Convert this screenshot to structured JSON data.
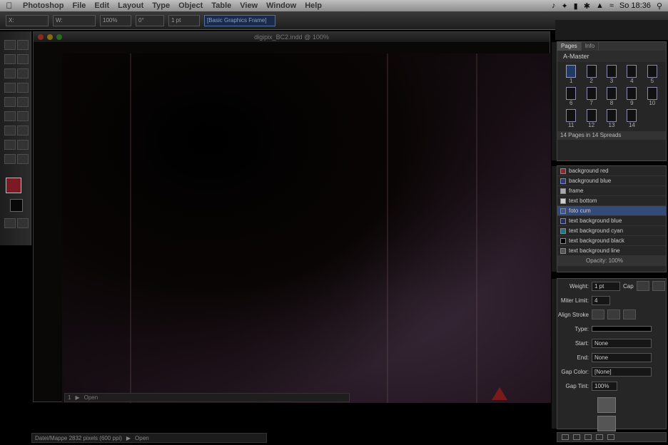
{
  "menubar": {
    "items": [
      "Photoshop",
      "File",
      "Edit",
      "Layout",
      "Type",
      "Object",
      "Table",
      "View",
      "Window",
      "Help"
    ],
    "clock": "So 18:36"
  },
  "control_bar": {
    "fields": [
      "X:",
      "W:",
      "100%",
      "0°",
      "1 pt"
    ],
    "frame_style": "[Basic Graphics Frame]"
  },
  "document": {
    "title": "digipix_BC2.indd @ 100%",
    "status_page": "1",
    "status_text": "Open"
  },
  "bottom_status": {
    "text": "Datei/Mappe 2832 pixels (600 ppi)",
    "open_label": "Open"
  },
  "pages_panel": {
    "tabs": [
      "Pages",
      "Info"
    ],
    "master_label": "A-Master",
    "page_numbers": [
      "1",
      "2",
      "3",
      "4",
      "5",
      "6",
      "7",
      "8",
      "9",
      "10",
      "11",
      "12",
      "13",
      "14"
    ],
    "footer": "14 Pages in 14 Spreads"
  },
  "swatches_panel": {
    "items": [
      {
        "name": "background red",
        "color": "#8a2a2a"
      },
      {
        "name": "background blue",
        "color": "#2a3a8a"
      },
      {
        "name": "frame",
        "color": "#aaaaaa"
      },
      {
        "name": "text bottom",
        "color": "#cfcfcf"
      },
      {
        "name": "foto cum",
        "color": "#3a5a9a"
      },
      {
        "name": "text background blue",
        "color": "#1f2f6a"
      },
      {
        "name": "text background cyan",
        "color": "#1a7a8a"
      },
      {
        "name": "text background black",
        "color": "#000000"
      },
      {
        "name": "text background line",
        "color": "#555555"
      }
    ],
    "selected_index": 4,
    "tint_label": "Opacity: 100%"
  },
  "stroke_panel": {
    "weight_label": "Weight:",
    "weight_value": "1 pt",
    "cap_label": "Cap",
    "miter_label": "Miter Limit:",
    "miter_value": "4",
    "align_label": "Align Stroke",
    "rows": [
      {
        "label": "Type:",
        "value": ""
      },
      {
        "label": "Start:",
        "value": "None"
      },
      {
        "label": "End:",
        "value": "None"
      },
      {
        "label": "Gap Color:",
        "value": "[None]"
      },
      {
        "label": "Gap Tint:",
        "value": "100%"
      }
    ]
  }
}
